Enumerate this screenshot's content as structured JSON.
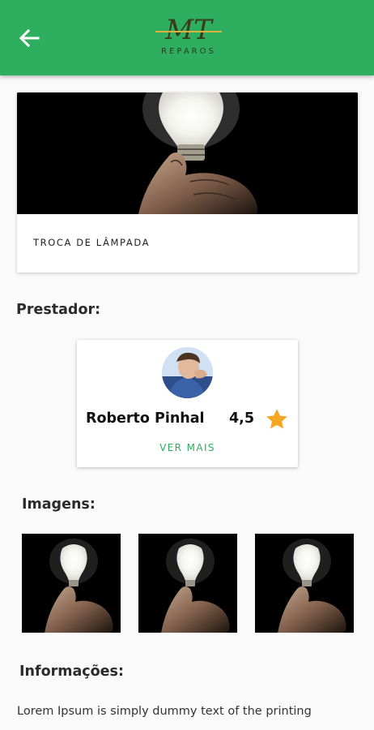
{
  "appbar": {
    "logo_text": "MT",
    "logo_subtext": "REPAROS",
    "back_icon": "arrow-left-icon",
    "color": "#2eaf5f"
  },
  "service": {
    "image_icon": "light-bulb-in-hand-photo",
    "title": "TROCA DE LÂMPADA"
  },
  "sections": {
    "provider_label": "Prestador:",
    "images_label": "Imagens:",
    "info_label": "Informações:"
  },
  "provider": {
    "name": "Roberto Pinhal",
    "rating": "4,5",
    "rating_icon": "star-icon",
    "star_color": "#f5a623",
    "more_label": "VER MAIS",
    "accent": "#2eaf5f"
  },
  "gallery": {
    "images": [
      "light-bulb-photo",
      "light-bulb-photo",
      "light-bulb-photo"
    ]
  },
  "info": {
    "text": "Lorem Ipsum is simply dummy text of the printing"
  }
}
